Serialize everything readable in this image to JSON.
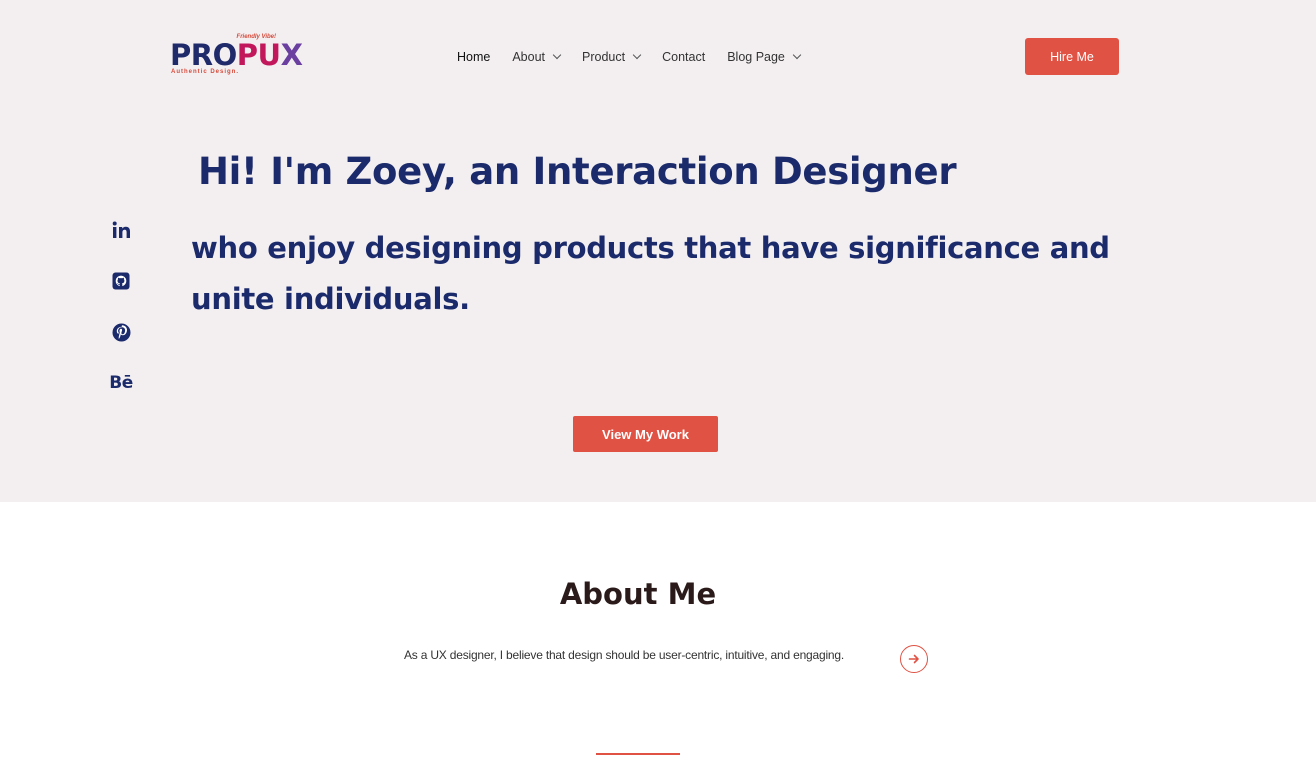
{
  "header": {
    "logo": {
      "parts": [
        "PRO",
        "PU",
        "X"
      ],
      "tagline": "Friendly Vibe!",
      "subtitle": "Authentic Design."
    },
    "nav": [
      {
        "label": "Home",
        "dropdown": false
      },
      {
        "label": "About",
        "dropdown": true
      },
      {
        "label": "Product",
        "dropdown": true
      },
      {
        "label": "Contact",
        "dropdown": false
      },
      {
        "label": "Blog Page",
        "dropdown": true
      }
    ],
    "cta": "Hire Me"
  },
  "social": [
    "linkedin-icon",
    "github-icon",
    "pinterest-icon",
    "behance-icon"
  ],
  "social_behance_text": "Bē",
  "hero": {
    "headline": "Hi! I'm Zoey, an Interaction Designer",
    "subheadline": "who enjoy designing products that have significance and unite individuals.",
    "button": "View My Work"
  },
  "about": {
    "title": "About Me",
    "text": "As a UX designer, I believe that design should be user-centric, intuitive, and engaging."
  },
  "colors": {
    "accent": "#e05244",
    "navy": "#1b2a6b",
    "hero_bg": "#f3eff1"
  }
}
